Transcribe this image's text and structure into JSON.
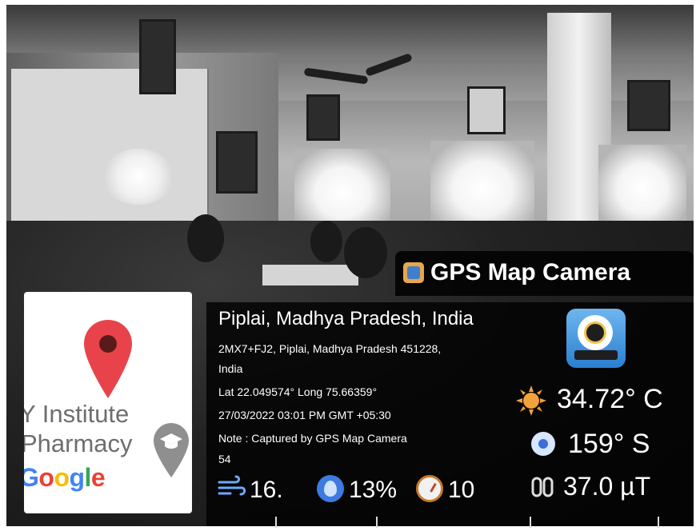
{
  "overlay": {
    "app_name": "GPS Map Camera",
    "place": "Piplai, Madhya Pradesh, India",
    "address_line1": "2MX7+FJ2, Piplai, Madhya Pradesh 451228,",
    "address_line2": "India",
    "lat_long": "Lat 22.049574° Long 75.66359°",
    "datetime": "27/03/2022 03:01 PM GMT +05:30",
    "note_line1": "Note : Captured by GPS Map Camera",
    "note_line2": "54"
  },
  "weather": {
    "temperature": "34.72° C",
    "direction": "159° S",
    "magnetic": "37.0 µT",
    "wind": "16.",
    "humidity": "13%",
    "pressure": "10"
  },
  "map": {
    "label_line1": "Y Institute",
    "label_line2": "Pharmacy",
    "google_letters": [
      "G",
      "o",
      "o",
      "g",
      "l",
      "e"
    ],
    "pin_color": "#E8434B"
  },
  "icons": {
    "app": "gps-map-camera-logo",
    "temperature": "sun-icon",
    "direction": "compass-icon",
    "magnetic": "magnet-icon",
    "wind": "wind-icon",
    "humidity": "humidity-icon",
    "pressure": "pressure-gauge-icon"
  }
}
